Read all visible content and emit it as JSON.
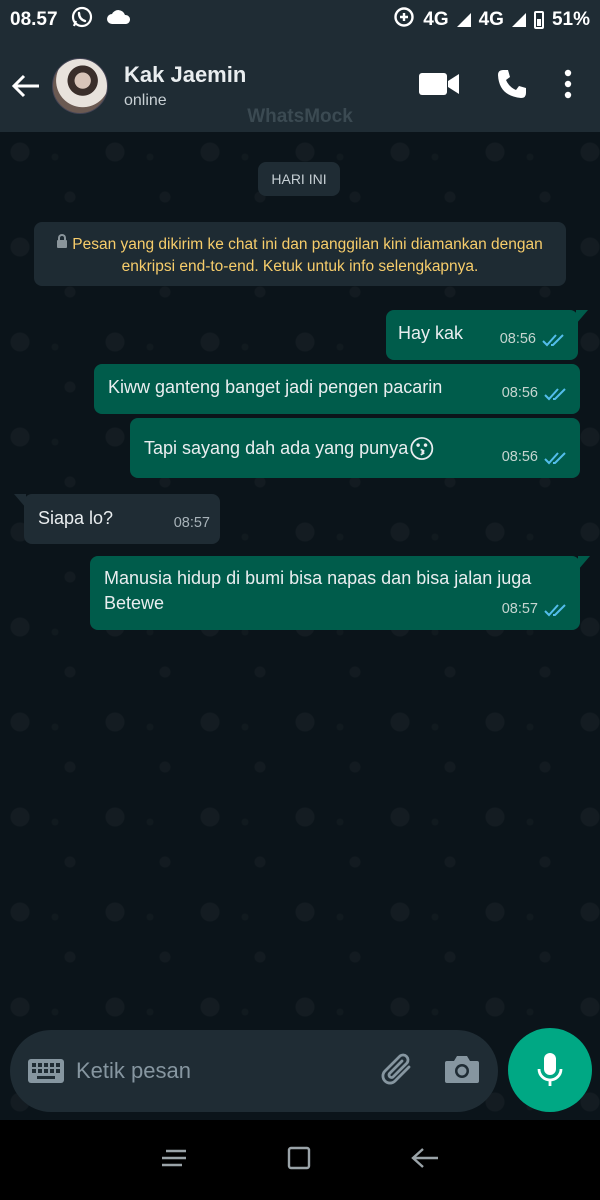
{
  "status_bar": {
    "time": "08.57",
    "network_1": "4G",
    "network_2": "4G",
    "battery": "51%"
  },
  "header": {
    "contact_name": "Kak Jaemin",
    "contact_status": "online",
    "watermark": "WhatsMock"
  },
  "chat": {
    "date_chip": "HARI INI",
    "e2e_notice": "Pesan yang dikirim ke chat ini dan panggilan kini diamankan dengan enkripsi end-to-end. Ketuk untuk info selengkapnya.",
    "messages": [
      {
        "direction": "out",
        "text": "Hay kak",
        "time": "08:56",
        "status": "read"
      },
      {
        "direction": "out",
        "text": "Kiww ganteng banget jadi pengen pacarin",
        "time": "08:56",
        "status": "read"
      },
      {
        "direction": "out",
        "text": "Tapi sayang dah ada yang punya",
        "emoji": "😗",
        "time": "08:56",
        "status": "read"
      },
      {
        "direction": "in",
        "text": "Siapa lo?",
        "time": "08:57"
      },
      {
        "direction": "out",
        "text": "Manusia hidup di bumi bisa napas dan bisa jalan juga Betewe",
        "time": "08:57",
        "status": "read"
      }
    ]
  },
  "input": {
    "placeholder": "Ketik pesan"
  },
  "colors": {
    "header_bg": "#1f2c34",
    "chat_bg": "#0b141a",
    "outgoing_bubble": "#005c4b",
    "incoming_bubble": "#1f2c34",
    "read_ticks": "#53bdeb",
    "mic_button": "#00a884",
    "notice_text": "#f7cd6b"
  },
  "icons": [
    "whatsapp-icon",
    "cloud-icon",
    "data-saver-icon",
    "signal-icon",
    "battery-icon",
    "back-arrow-icon",
    "video-call-icon",
    "phone-icon",
    "more-options-icon",
    "lock-icon",
    "double-check-icon",
    "keyboard-icon",
    "attach-icon",
    "camera-icon",
    "mic-icon",
    "recents-icon",
    "home-icon",
    "back-icon"
  ]
}
